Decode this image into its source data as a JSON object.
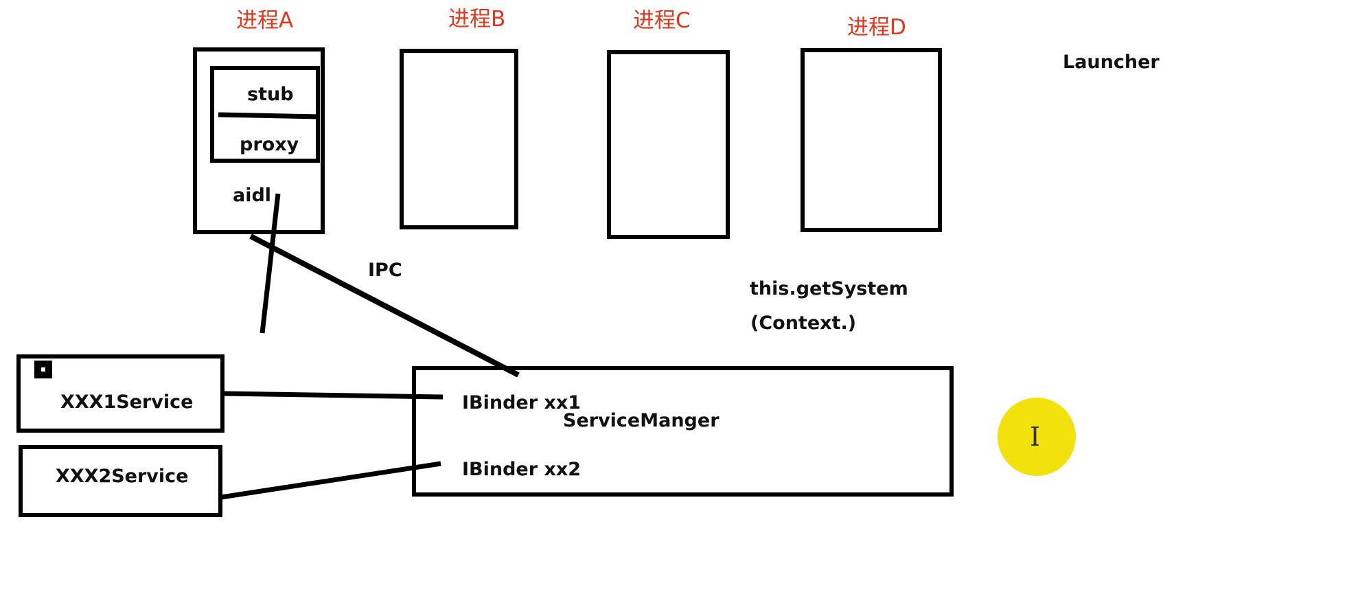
{
  "processes": [
    {
      "label": "进程A"
    },
    {
      "label": "进程B"
    },
    {
      "label": "进程C"
    },
    {
      "label": "进程D"
    }
  ],
  "process_a": {
    "stub_label": "stub",
    "proxy_label": "proxy",
    "aidl_label": "aidl"
  },
  "launcher_label": "Launcher",
  "ipc_label": "IPC",
  "get_system": {
    "line1": "this.getSystem",
    "line2": "(Context.)"
  },
  "services": [
    {
      "label": "XXX1Service"
    },
    {
      "label": "XXX2Service"
    }
  ],
  "service_manager": {
    "title": "ServiceManger",
    "binder1": "IBinder xx1",
    "binder2": "IBinder xx2"
  },
  "colors": {
    "process_label": "#e2371a",
    "stroke": "#000000",
    "cursor_highlight": "#f2df00"
  },
  "icons": {
    "cursor": "text-cursor-icon",
    "marker": "small-square-icon"
  }
}
